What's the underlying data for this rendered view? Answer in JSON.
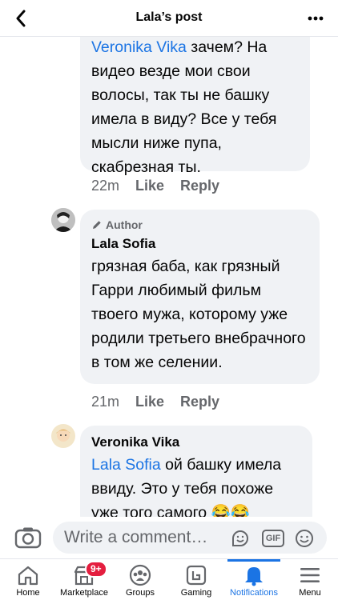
{
  "header": {
    "title": "Lala’s post"
  },
  "comments": [
    {
      "mention": "Veronika Vika",
      "text_after_mention": " зачем? На видео везде мои свои волосы, так ты не башку имела в виду? Все у тебя мысли ниже пупа, скабрезная ты.",
      "time": "22m",
      "like_label": "Like",
      "reply_label": "Reply"
    },
    {
      "badge": "Author",
      "author": "Lala Sofia",
      "text": "грязная баба, как грязный Гарри любимый фильм твоего мужа, которому уже родили третьего внебрачного в том же селении.",
      "time": "21m",
      "like_label": "Like",
      "reply_label": "Reply"
    },
    {
      "author": "Veronika Vika",
      "mention": "Lala Sofia",
      "text_after_mention": " ой башку имела ввиду. Это у тебя похоже уже того самого 😂😂"
    }
  ],
  "composer": {
    "placeholder": "Write a comment…",
    "gif_label": "GIF"
  },
  "tabbar": {
    "tabs": [
      {
        "label": "Home"
      },
      {
        "label": "Marketplace",
        "badge": "9+"
      },
      {
        "label": "Groups"
      },
      {
        "label": "Gaming"
      },
      {
        "label": "Notifications"
      },
      {
        "label": "Menu"
      }
    ],
    "active": "Notifications"
  },
  "colors": {
    "accent": "#1b74e4",
    "bubble": "#f0f2f5",
    "badge": "#e41e3f",
    "secondary_text": "#65676b"
  }
}
